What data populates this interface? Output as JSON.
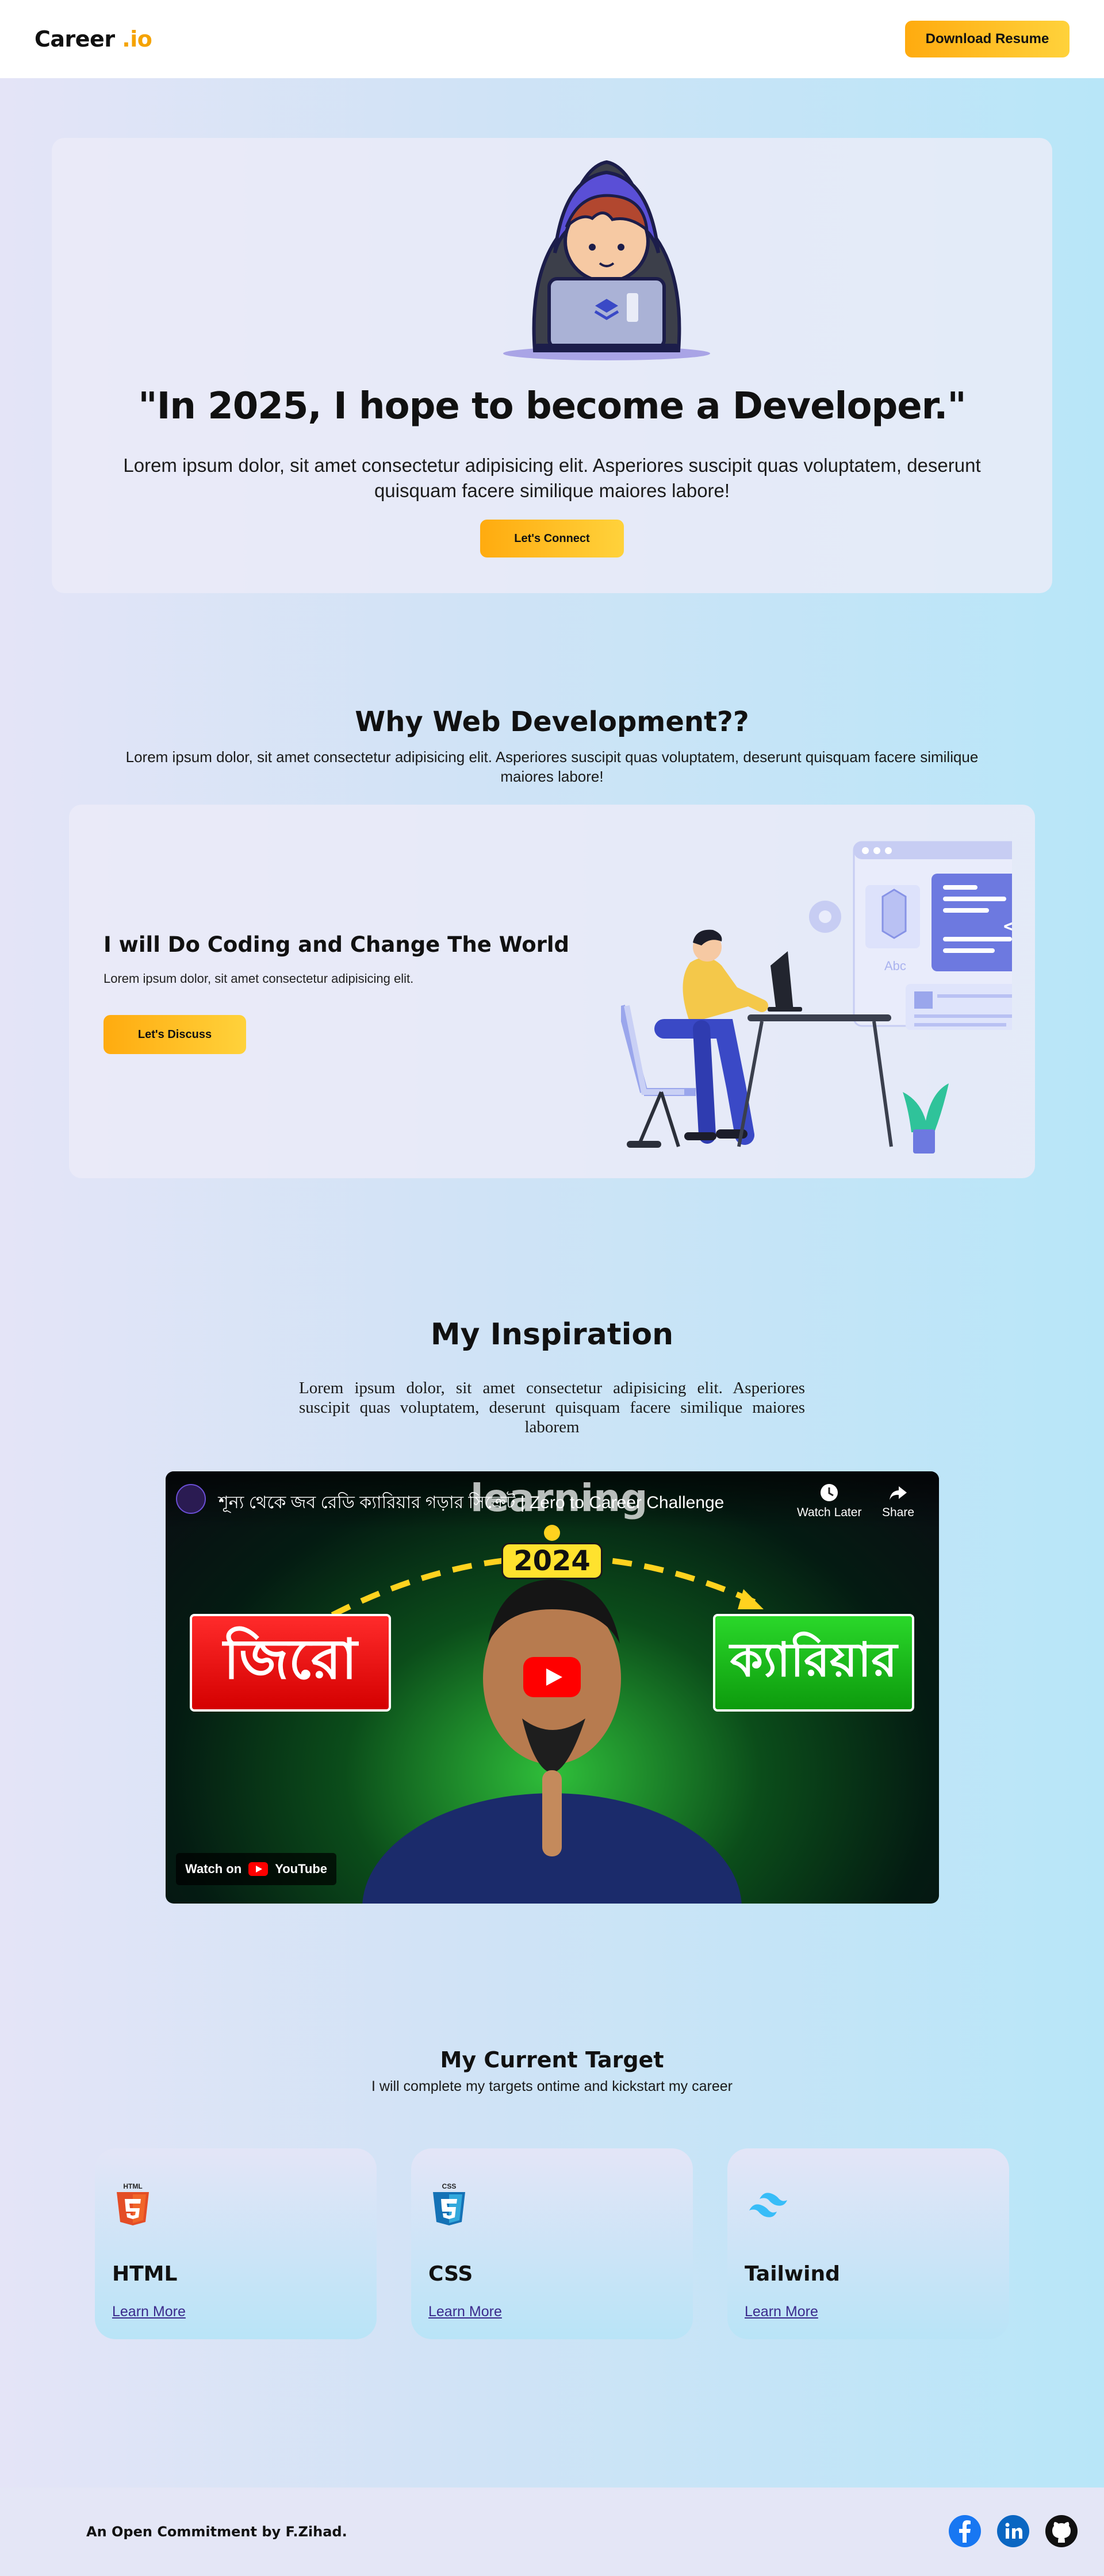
{
  "navbar": {
    "logo_main": "Career",
    "logo_accent": ".io",
    "download_button": "Download Resume"
  },
  "hero": {
    "title": "\"In 2025, I hope to become a Developer.\"",
    "text": "Lorem ipsum dolor, sit amet consectetur adipisicing elit. Asperiores suscipit quas voluptatem, deserunt quisquam facere similique maiores labore!",
    "button": "Let's Connect"
  },
  "why": {
    "title": "Why Web Development??",
    "subtitle": "Lorem ipsum dolor, sit amet consectetur adipisicing elit. Asperiores suscipit quas voluptatem, deserunt quisquam facere similique maiores labore!",
    "card_heading": "I will Do Coding and Change The World",
    "card_text": "Lorem ipsum dolor, sit amet consectetur adipisicing elit.",
    "card_button": "Let's Discuss",
    "illus_abc": "Abc",
    "illus_code": "</>"
  },
  "inspiration": {
    "title": "My Inspiration",
    "text": "Lorem ipsum dolor, sit amet consectetur adipisicing elit. Asperiores suscipit quas voluptatem, deserunt quisquam facere similique maiores laborem",
    "video": {
      "title": "শূন্য থেকে জব রেডি ক্যারিয়ার গড়ার সিক্রেট | Zero to Career Challenge",
      "overlay_word": "learning",
      "watch_later": "Watch Later",
      "share": "Share",
      "year": "2024",
      "left_word": "জিরো",
      "right_word": "ক্যারিয়ার",
      "watch_on": "Watch on",
      "youtube": "YouTube"
    }
  },
  "target": {
    "title": "My Current Target",
    "subtitle": "I will complete my targets ontime and kickstart my career",
    "cards": [
      {
        "name": "HTML",
        "link": "Learn More",
        "icon": "html5-icon",
        "badge": "HTML"
      },
      {
        "name": "CSS",
        "link": "Learn More",
        "icon": "css3-icon",
        "badge": "CSS"
      },
      {
        "name": "Tailwind",
        "link": "Learn More",
        "icon": "tailwind-icon"
      }
    ]
  },
  "footer": {
    "text": "An Open Commitment by F.Zihad.",
    "social": [
      "facebook-icon",
      "linkedin-icon",
      "github-icon"
    ]
  },
  "colors": {
    "accent_yellow": "#ffab0f",
    "accent_yellow_light": "#ffd23b",
    "link": "#3b2a8c",
    "facebook": "#1877f2",
    "linkedin": "#0a66c2"
  }
}
